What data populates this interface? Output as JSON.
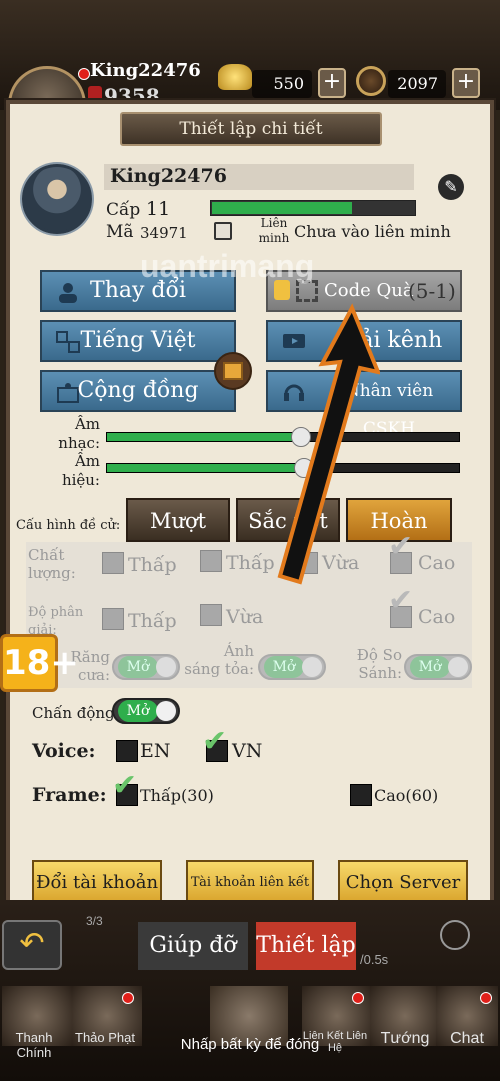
{
  "hud": {
    "player_name": "King22476",
    "power": "9358",
    "gold": "550",
    "coins": "2097",
    "plus": "+"
  },
  "dialog": {
    "title": "Thiết lập chi tiết",
    "profile": {
      "name": "King22476",
      "level_label": "Cấp",
      "level": "11",
      "id_label": "Mã",
      "id": "34971",
      "alliance_label": "Liên minh",
      "alliance_status": "Chưa vào liên minh"
    },
    "buttons": {
      "change": "Thay đổi",
      "code": "Code Quà",
      "code_tag": "(5-1)",
      "language": "Tiếng Việt",
      "channel": "Tải kênh",
      "community": "Cộng đồng",
      "support": "Nhân viên CSKH"
    },
    "sliders": {
      "music_label": "Âm nhạc:",
      "music_level": 0.55,
      "sound_label": "Âm hiệu:",
      "sound_level": 0.56
    },
    "presets": {
      "label": "Cấu hình đề cử:",
      "smooth": "Mượt",
      "sharp": "Sắc nét",
      "perfect": "Hoàn hảo"
    },
    "quality": {
      "quality_label": "Chất lượng:",
      "low": "Thấp",
      "low2": "Thấp",
      "mid": "Vừa",
      "high": "Cao",
      "resolution_label": "Độ phân giải:",
      "res_low": "Thấp",
      "res_mid": "Vừa",
      "res_high": "Cao",
      "aa_label": "Răng cưa:",
      "glow_label": "Ánh sáng tỏa:",
      "contrast_label": "Độ So Sánh:",
      "on": "Mở"
    },
    "vibration": {
      "label": "Chấn động:",
      "state": "Mở"
    },
    "voice": {
      "label": "Voice:",
      "en": "EN",
      "vn": "VN"
    },
    "frame": {
      "label": "Frame:",
      "low": "Thấp(30)",
      "high": "Cao(60)"
    },
    "footer": {
      "switch_account": "Đổi tài khoản",
      "linked_account": "Tài khoản liên kết",
      "choose_server": "Chọn Server"
    }
  },
  "bottom": {
    "help": "Giúp đỡ",
    "settings": "Thiết lập",
    "labels": [
      "Thanh Chính",
      "Thảo Phạt",
      "Liên",
      "Liên Kết Liên Hệ",
      "Tướng",
      "Chat"
    ],
    "tap_hint": "Nhấp bất kỳ để đóng",
    "counter": "3/3",
    "timer": "/0.5s"
  },
  "age_badge": "18+",
  "watermark": "uantrimang",
  "colors": {
    "accent_blue": "#4a7fa4",
    "gold": "#e0a43c",
    "green": "#2fae4c",
    "arrow": "#e27a1c"
  }
}
